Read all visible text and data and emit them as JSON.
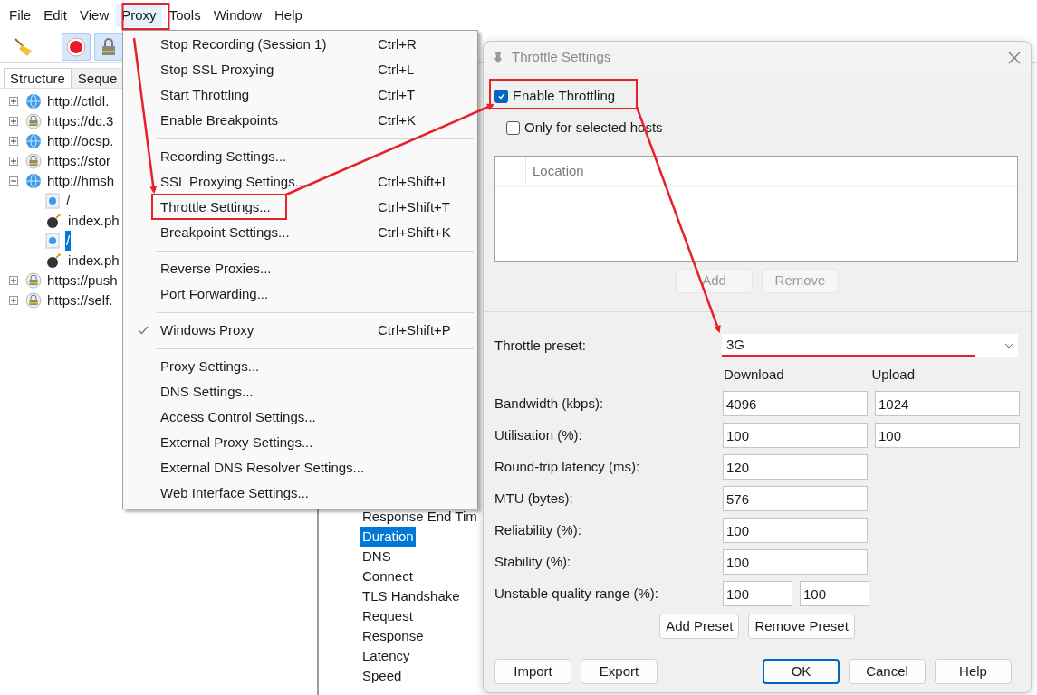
{
  "menu_bar": [
    {
      "label": "File",
      "selected": false
    },
    {
      "label": "Edit",
      "selected": false
    },
    {
      "label": "View",
      "selected": false
    },
    {
      "label": "Proxy",
      "selected": true
    },
    {
      "label": "Tools",
      "selected": false
    },
    {
      "label": "Window",
      "selected": false
    },
    {
      "label": "Help",
      "selected": false
    }
  ],
  "toolbar": [
    {
      "kind": "broom",
      "pressed": false
    },
    {
      "kind": "record",
      "pressed": true
    },
    {
      "kind": "lock",
      "pressed": true
    }
  ],
  "left_tabs": [
    {
      "label": "Structure",
      "selected": true
    },
    {
      "label": "Seque",
      "selected": false
    }
  ],
  "tree": [
    {
      "label": "http://ctldl.",
      "kind": "globe",
      "expanded": false,
      "selected": false
    },
    {
      "label": "https://dc.3",
      "kind": "lock",
      "expanded": false,
      "selected": false
    },
    {
      "label": "http://ocsp.",
      "kind": "globe",
      "expanded": false,
      "selected": false
    },
    {
      "label": "https://stor",
      "kind": "lock",
      "expanded": false,
      "selected": false
    },
    {
      "label": "http://hmsh",
      "kind": "globe",
      "expanded": true,
      "selected": false,
      "children": [
        {
          "label": "/",
          "kind": "doc",
          "selected": false
        },
        {
          "label": "index.ph",
          "kind": "bomb",
          "selected": false
        },
        {
          "label": "/",
          "kind": "doc",
          "selected": true
        },
        {
          "label": "index.ph",
          "kind": "bomb",
          "selected": false
        }
      ]
    },
    {
      "label": "https://push",
      "kind": "lock",
      "expanded": false,
      "selected": false
    },
    {
      "label": "https://self.",
      "kind": "lock",
      "expanded": false,
      "selected": false
    }
  ],
  "timing_list": [
    {
      "label": "Response End Tim",
      "selected": false
    },
    {
      "label": "Duration",
      "selected": true
    },
    {
      "label": "DNS",
      "selected": false
    },
    {
      "label": "Connect",
      "selected": false
    },
    {
      "label": "TLS Handshake",
      "selected": false
    },
    {
      "label": "Request",
      "selected": false
    },
    {
      "label": "Response",
      "selected": false
    },
    {
      "label": "Latency",
      "selected": false
    },
    {
      "label": "Speed",
      "selected": false
    }
  ],
  "proxy_menu": [
    [
      {
        "label": "Stop Recording (Session 1)",
        "shortcut": "Ctrl+R",
        "checked": false
      },
      {
        "label": "Stop SSL Proxying",
        "shortcut": "Ctrl+L",
        "checked": false
      },
      {
        "label": "Start Throttling",
        "shortcut": "Ctrl+T",
        "checked": false
      },
      {
        "label": "Enable Breakpoints",
        "shortcut": "Ctrl+K",
        "checked": false
      }
    ],
    [
      {
        "label": "Recording Settings...",
        "checked": false
      },
      {
        "label": "SSL Proxying Settings...",
        "shortcut": "Ctrl+Shift+L",
        "checked": false
      },
      {
        "label": "Throttle Settings...",
        "shortcut": "Ctrl+Shift+T",
        "checked": false
      },
      {
        "label": "Breakpoint Settings...",
        "shortcut": "Ctrl+Shift+K",
        "checked": false
      }
    ],
    [
      {
        "label": "Reverse Proxies...",
        "checked": false
      },
      {
        "label": "Port Forwarding...",
        "checked": false
      }
    ],
    [
      {
        "label": "Windows Proxy",
        "shortcut": "Ctrl+Shift+P",
        "checked": true
      }
    ],
    [
      {
        "label": "Proxy Settings...",
        "checked": false
      },
      {
        "label": "DNS Settings...",
        "checked": false
      },
      {
        "label": "Access Control Settings...",
        "checked": false
      },
      {
        "label": "External Proxy Settings...",
        "checked": false
      },
      {
        "label": "External DNS Resolver Settings...",
        "checked": false
      },
      {
        "label": "Web Interface Settings...",
        "checked": false
      }
    ]
  ],
  "dialog": {
    "title": "Throttle Settings",
    "enable_throttling": {
      "label": "Enable Throttling",
      "checked": true
    },
    "only_selected_hosts": {
      "label": "Only for selected hosts",
      "checked": false
    },
    "hosts_table": {
      "columns": [
        "Location"
      ]
    },
    "host_buttons": [
      {
        "label": "Add",
        "disabled": true
      },
      {
        "label": "Remove",
        "disabled": true
      }
    ],
    "preset": {
      "label": "Throttle preset:",
      "value": "3G"
    },
    "column_headers": [
      "Download",
      "Upload"
    ],
    "rows": [
      {
        "label": "Bandwidth (kbps):",
        "kind": "columns",
        "values": [
          "4096",
          "1024"
        ]
      },
      {
        "label": "Utilisation (%):",
        "kind": "columns",
        "values": [
          "100",
          "100"
        ]
      },
      {
        "label": "Round-trip latency (ms):",
        "kind": "columns",
        "values": [
          "120"
        ]
      },
      {
        "label": "MTU (bytes):",
        "kind": "columns",
        "values": [
          "576"
        ]
      },
      {
        "label": "Reliability (%):",
        "kind": "columns",
        "values": [
          "100"
        ]
      },
      {
        "label": "Stability (%):",
        "kind": "columns",
        "values": [
          "100"
        ]
      },
      {
        "label": "Unstable quality range (%):",
        "kind": "range",
        "values": [
          "100",
          "100"
        ]
      }
    ],
    "preset_buttons": [
      "Add Preset",
      "Remove Preset"
    ],
    "footer_left": [
      "Import",
      "Export"
    ],
    "footer_right": [
      {
        "label": "OK",
        "default": true
      },
      {
        "label": "Cancel",
        "default": false
      },
      {
        "label": "Help",
        "default": false
      }
    ]
  }
}
